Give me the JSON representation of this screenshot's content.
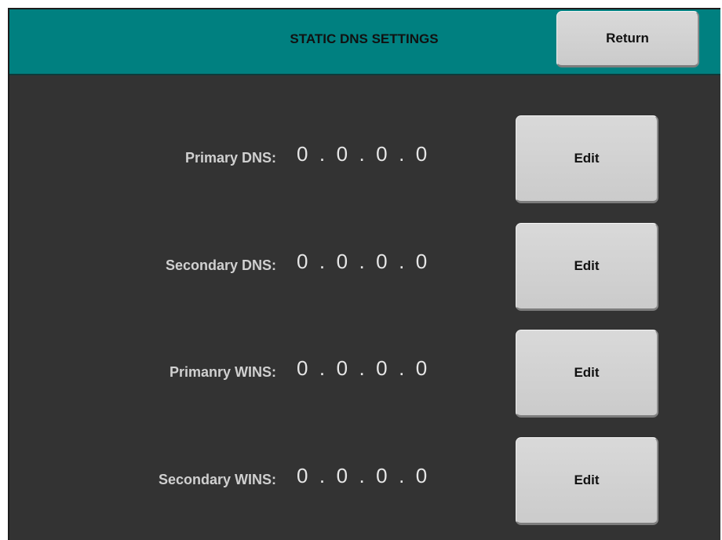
{
  "header": {
    "title": "STATIC DNS SETTINGS",
    "return_label": "Return"
  },
  "rows": [
    {
      "label": "Primary DNS:",
      "value": "0  .  0  .  0  .  0",
      "edit_label": "Edit"
    },
    {
      "label": "Secondary DNS:",
      "value": "0  .  0  .  0  .  0",
      "edit_label": "Edit"
    },
    {
      "label": "Primanry WINS:",
      "value": "0  .  0  .  0  .  0",
      "edit_label": "Edit"
    },
    {
      "label": "Secondary WINS:",
      "value": "0  .  0  .  0  .  0",
      "edit_label": "Edit"
    }
  ],
  "colors": {
    "header_bg": "#008080",
    "screen_bg": "#333333",
    "button_bg": "#d3d3d3",
    "label_text": "#d0d0d0"
  }
}
